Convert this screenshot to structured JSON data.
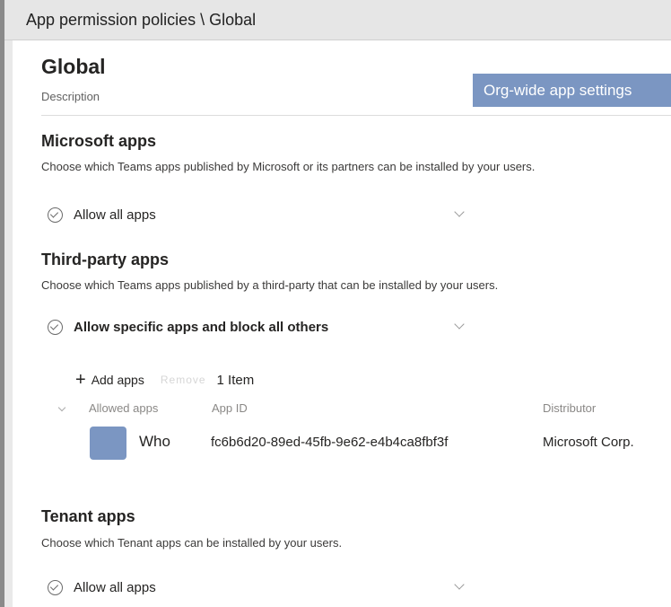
{
  "breadcrumb": "App permission policies \\ Global",
  "page": {
    "title": "Global",
    "description": "Description",
    "org_button_label": "Org-wide app settings"
  },
  "microsoft_apps": {
    "title": "Microsoft apps",
    "description": "Choose which Teams apps published by Microsoft or its partners can be installed by your users.",
    "dropdown_value": "Allow all apps"
  },
  "third_party_apps": {
    "title": "Third-party apps",
    "description": "Choose which Teams apps published by a third-party that can be installed by your users.",
    "dropdown_value": "Allow specific apps and block all others",
    "toolbar": {
      "add_label": "Add apps",
      "remove_label": "Remove",
      "item_count": "1 Item"
    },
    "table": {
      "columns": [
        "Allowed apps",
        "App ID",
        "Distributor"
      ],
      "rows": [
        {
          "name": "Who",
          "app_id": "fc6b6d20-89ed-45fb-9e62-e4b4ca8fbf3f",
          "distributor": "Microsoft Corp."
        }
      ]
    }
  },
  "tenant_apps": {
    "title": "Tenant apps",
    "description": "Choose which Tenant apps can be installed by your users.",
    "dropdown_value": "Allow all apps"
  }
}
